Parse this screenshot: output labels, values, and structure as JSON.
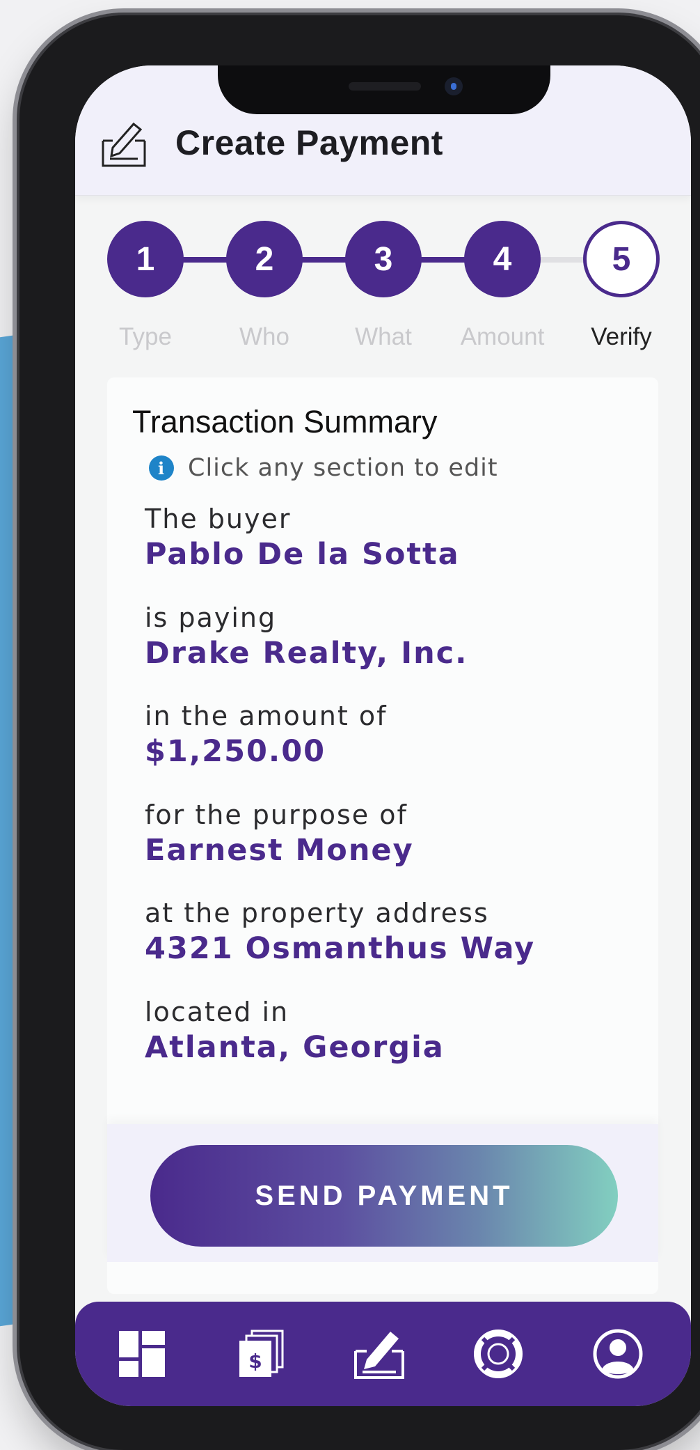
{
  "header": {
    "title": "Create Payment",
    "icon": "edit-form-icon"
  },
  "stepper": {
    "steps": [
      {
        "number": "1",
        "label": "Type",
        "state": "done"
      },
      {
        "number": "2",
        "label": "Who",
        "state": "done"
      },
      {
        "number": "3",
        "label": "What",
        "state": "done"
      },
      {
        "number": "4",
        "label": "Amount",
        "state": "done"
      },
      {
        "number": "5",
        "label": "Verify",
        "state": "current"
      }
    ]
  },
  "summary": {
    "title": "Transaction Summary",
    "hint": "Click any section to edit",
    "rows": [
      {
        "label": "The buyer",
        "value": "Pablo De la Sotta"
      },
      {
        "label": "is paying",
        "value": "Drake Realty, Inc."
      },
      {
        "label": "in the amount of",
        "value": "$1,250.00"
      },
      {
        "label": "for the purpose of",
        "value": "Earnest Money"
      },
      {
        "label": "at the property address",
        "value": "4321 Osmanthus Way"
      },
      {
        "label": "located in",
        "value": "Atlanta, Georgia"
      }
    ]
  },
  "actions": {
    "send_label": "SEND PAYMENT"
  },
  "navbar": {
    "items": [
      "dashboard-icon",
      "payments-icon",
      "create-payment-icon",
      "support-icon",
      "profile-icon"
    ]
  },
  "colors": {
    "primary": "#4a2a8c",
    "accent_end": "#82cfc0",
    "info": "#1e84c8"
  }
}
